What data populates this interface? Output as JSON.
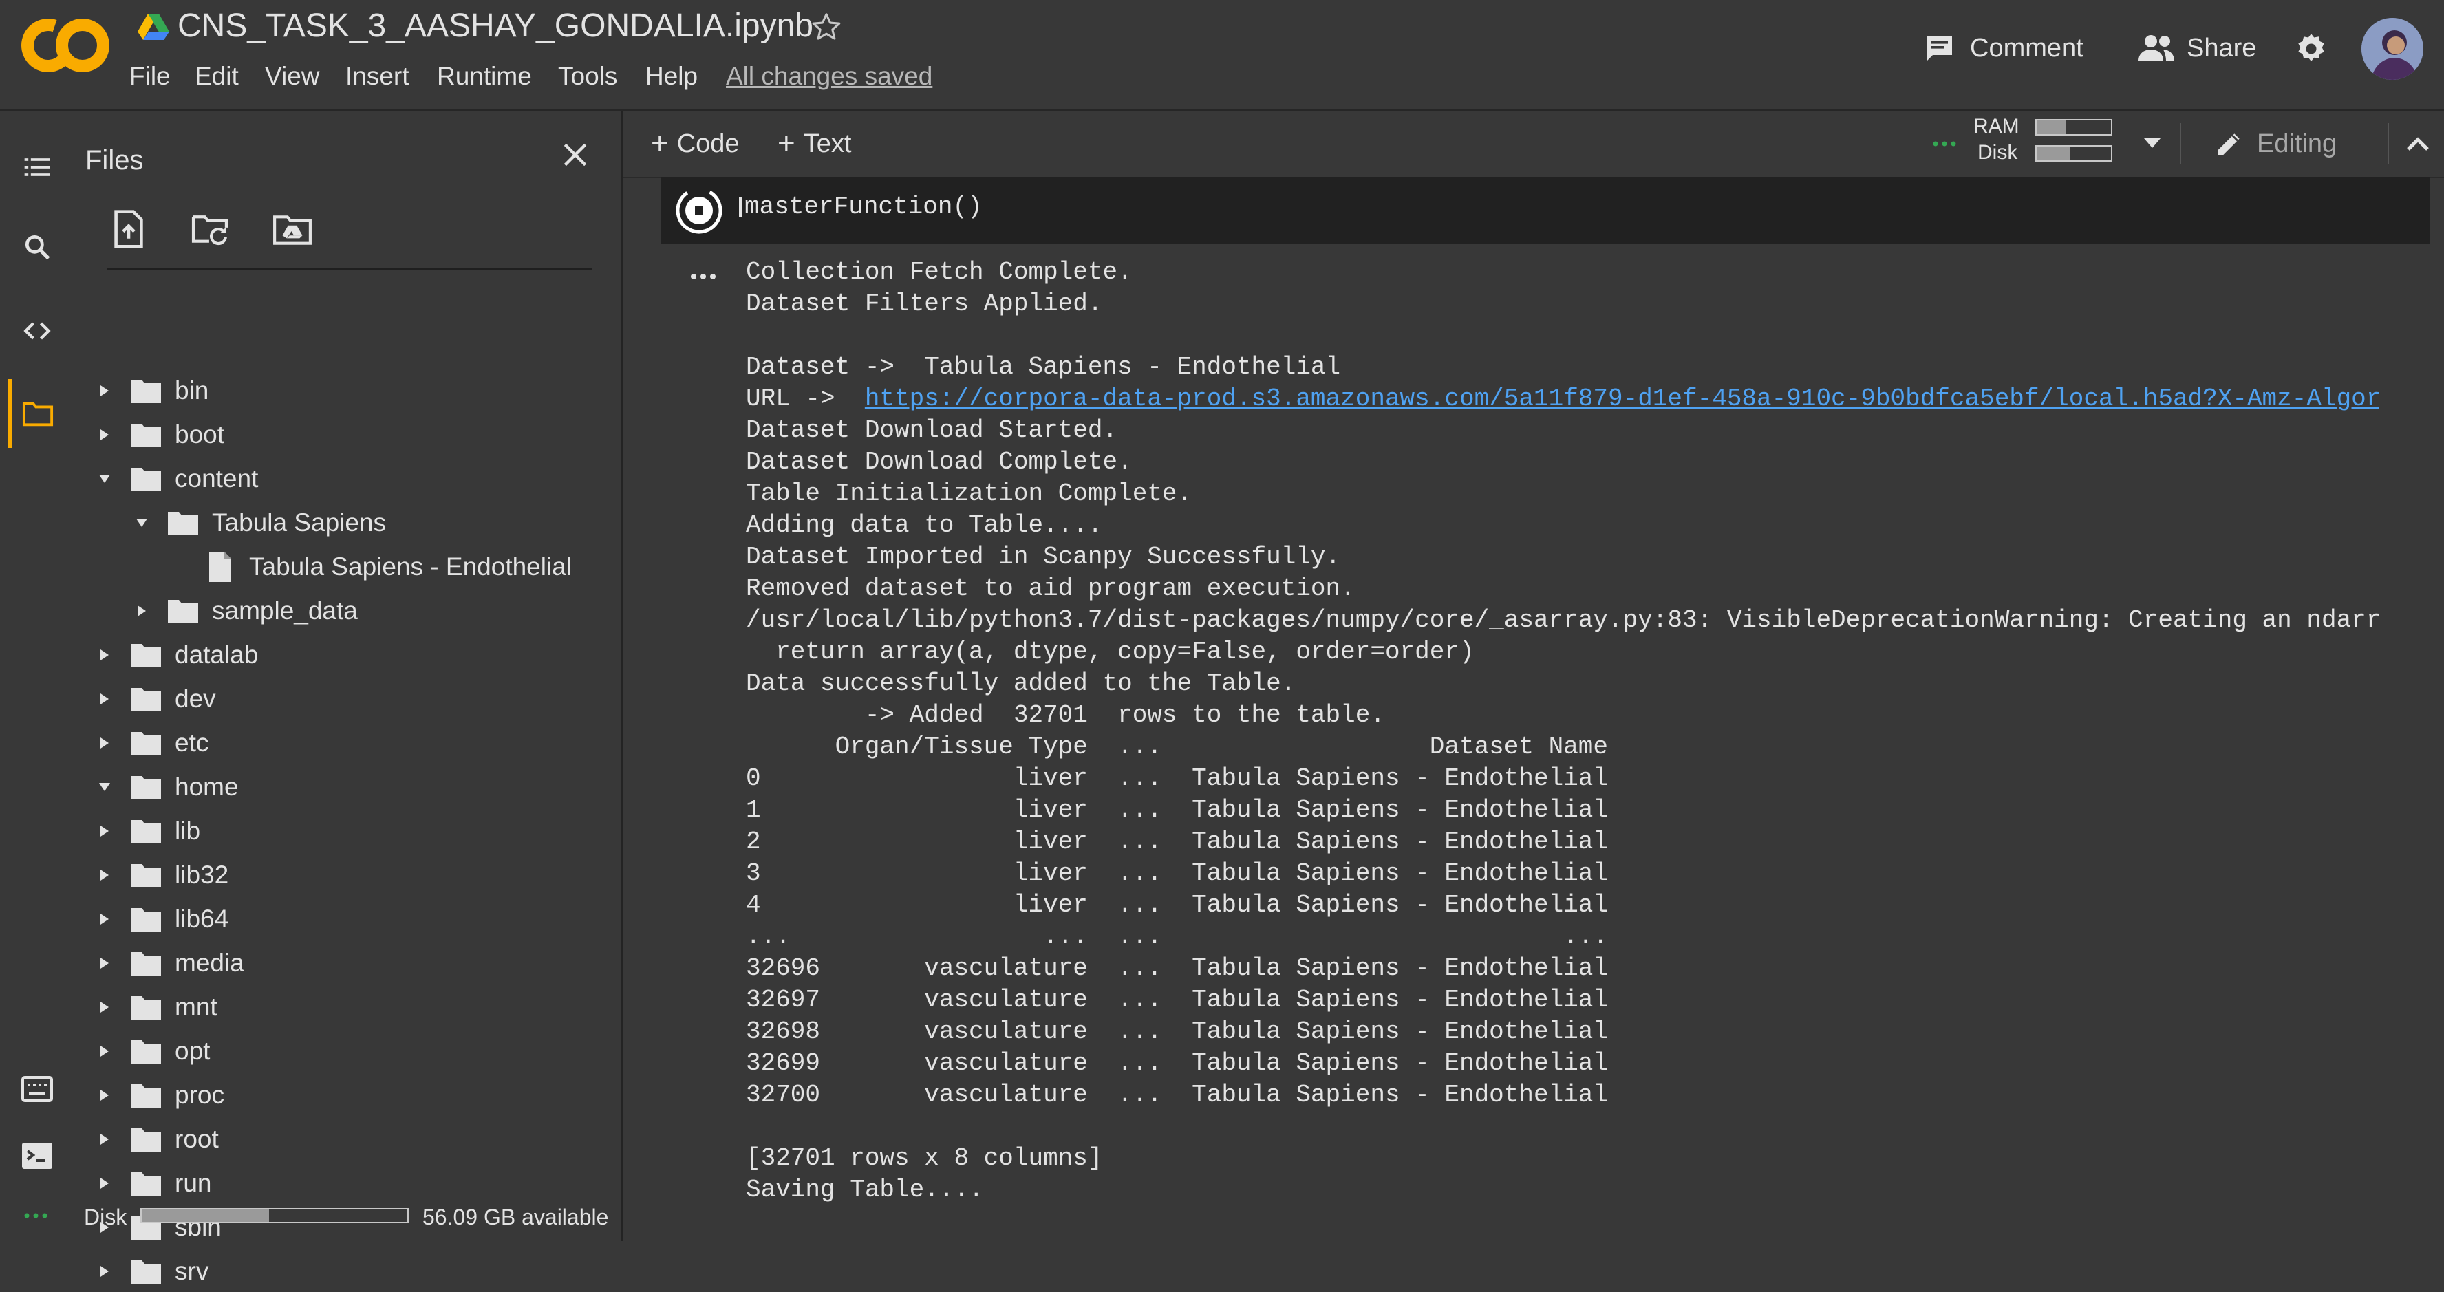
{
  "header": {
    "logo": "CO",
    "title": "CNS_TASK_3_AASHAY_GONDALIA.ipynb",
    "menu": [
      "File",
      "Edit",
      "View",
      "Insert",
      "Runtime",
      "Tools",
      "Help"
    ],
    "save_status": "All changes saved",
    "comment_label": "Comment",
    "share_label": "Share"
  },
  "files_panel": {
    "title": "Files",
    "tree": [
      {
        "label": "bin",
        "type": "folder",
        "expanded": false
      },
      {
        "label": "boot",
        "type": "folder",
        "expanded": false
      },
      {
        "label": "content",
        "type": "folder",
        "expanded": true
      },
      {
        "label": "Tabula Sapiens",
        "type": "folder",
        "expanded": true
      },
      {
        "label": "Tabula Sapiens - Endothelial",
        "type": "file"
      },
      {
        "label": "sample_data",
        "type": "folder",
        "expanded": false
      },
      {
        "label": "datalab",
        "type": "folder",
        "expanded": false
      },
      {
        "label": "dev",
        "type": "folder",
        "expanded": false
      },
      {
        "label": "etc",
        "type": "folder",
        "expanded": false
      },
      {
        "label": "home",
        "type": "folder",
        "expanded": true
      },
      {
        "label": "lib",
        "type": "folder",
        "expanded": false
      },
      {
        "label": "lib32",
        "type": "folder",
        "expanded": false
      },
      {
        "label": "lib64",
        "type": "folder",
        "expanded": false
      },
      {
        "label": "media",
        "type": "folder",
        "expanded": false
      },
      {
        "label": "mnt",
        "type": "folder",
        "expanded": false
      },
      {
        "label": "opt",
        "type": "folder",
        "expanded": false
      },
      {
        "label": "proc",
        "type": "folder",
        "expanded": false
      },
      {
        "label": "root",
        "type": "folder",
        "expanded": false
      },
      {
        "label": "run",
        "type": "folder",
        "expanded": false
      },
      {
        "label": "sbin",
        "type": "folder",
        "expanded": false
      },
      {
        "label": "srv",
        "type": "folder",
        "expanded": false
      }
    ],
    "disk_label": "Disk",
    "disk_available": "56.09 GB available",
    "disk_used_fraction": 0.48
  },
  "toolbar": {
    "code_label": "Code",
    "text_label": "Text",
    "ram_label": "RAM",
    "disk_label": "Disk",
    "ram_used_fraction": 0.4,
    "disk_used_fraction": 0.45,
    "editing_label": "Editing"
  },
  "cell": {
    "code": "masterFunction()"
  },
  "output_lines": [
    "Collection Fetch Complete.",
    "Dataset Filters Applied.",
    "",
    "Dataset ->  Tabula Sapiens - Endothelial",
    "URL ->  https://corpora-data-prod.s3.amazonaws.com/5a11f879-d1ef-458a-910c-9b0bdfca5ebf/local.h5ad?X-Amz-Algor",
    "Dataset Download Started.",
    "Dataset Download Complete.",
    "Table Initialization Complete.",
    "Adding data to Table....",
    "Dataset Imported in Scanpy Successfully.",
    "Removed dataset to aid program execution.",
    "/usr/local/lib/python3.7/dist-packages/numpy/core/_asarray.py:83: VisibleDeprecationWarning: Creating an ndarr",
    "  return array(a, dtype, copy=False, order=order)",
    "Data successfully added to the Table.",
    "        -> Added  32701  rows to the table.",
    "      Organ/Tissue Type  ...                  Dataset Name",
    "0                 liver  ...  Tabula Sapiens - Endothelial",
    "1                 liver  ...  Tabula Sapiens - Endothelial",
    "2                 liver  ...  Tabula Sapiens - Endothelial",
    "3                 liver  ...  Tabula Sapiens - Endothelial",
    "4                 liver  ...  Tabula Sapiens - Endothelial",
    "...                 ...  ...                           ...",
    "32696       vasculature  ...  Tabula Sapiens - Endothelial",
    "32697       vasculature  ...  Tabula Sapiens - Endothelial",
    "32698       vasculature  ...  Tabula Sapiens - Endothelial",
    "32699       vasculature  ...  Tabula Sapiens - Endothelial",
    "32700       vasculature  ...  Tabula Sapiens - Endothelial",
    "",
    "[32701 rows x 8 columns]",
    "Saving Table...."
  ],
  "url_prefix": "URL ->  ",
  "url_text": "https://corpora-data-prod.s3.amazonaws.com/5a11f879-d1ef-458a-910c-9b0bdfca5ebf/local.h5ad?X-Amz-Algor",
  "colors": {
    "background": "#383838",
    "cell_background": "#212121",
    "link": "#4fa2f2",
    "logo_orange": "#f9ab00",
    "status_green": "#34a853"
  }
}
